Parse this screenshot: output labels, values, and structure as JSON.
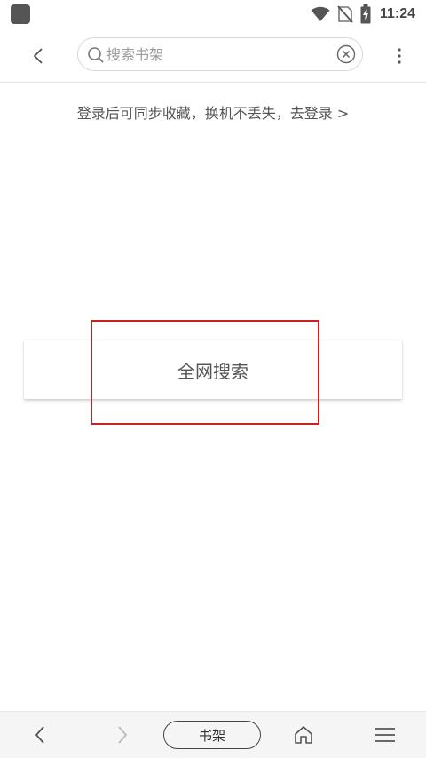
{
  "status_bar": {
    "time": "11:24",
    "icons": [
      "app-indicator-icon",
      "wifi-icon",
      "no-sim-icon",
      "battery-charging-icon"
    ]
  },
  "top_bar": {
    "search_placeholder": "搜索书架",
    "icons": [
      "back-chevron-icon",
      "search-icon",
      "clear-circle-x-icon",
      "more-vertical-icon"
    ]
  },
  "login_prompt": "登录后可同步收藏，换机不丢失，去登录 >",
  "search_all_label": "全网搜索",
  "bottom_nav": {
    "bookshelf_label": "书架",
    "icons": [
      "back-icon",
      "forward-icon",
      "home-icon",
      "menu-icon"
    ]
  },
  "colors": {
    "highlight": "#cc1f1f",
    "text": "#555555",
    "nav_bg": "#f5f5f5"
  }
}
